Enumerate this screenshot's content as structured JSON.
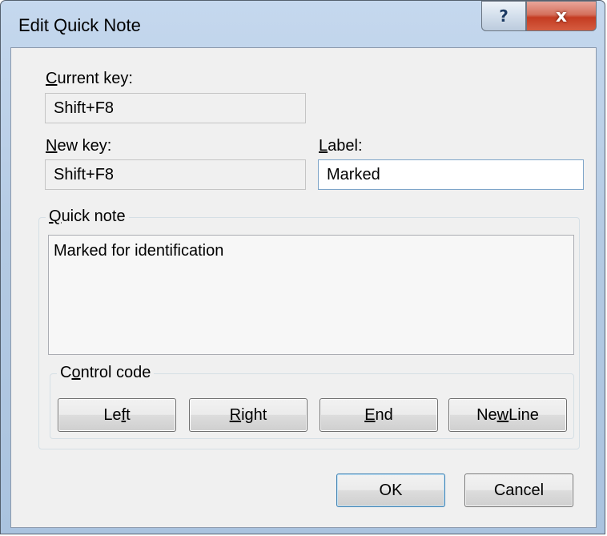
{
  "window": {
    "title": "Edit Quick Note",
    "help_glyph": "?",
    "close_glyph": "x"
  },
  "current_key": {
    "label_mnemonic": "C",
    "label_rest": "urrent key:",
    "value": "Shift+F8"
  },
  "new_key": {
    "label_mnemonic": "N",
    "label_rest": "ew key:",
    "value": "Shift+F8"
  },
  "label_field": {
    "label_mnemonic": "L",
    "label_rest": "abel:",
    "value": "Marked"
  },
  "quick_note": {
    "legend_mnemonic": "Q",
    "legend_rest": "uick note",
    "text": "Marked for identification"
  },
  "control_code": {
    "legend_pre": "C",
    "legend_mnemonic": "o",
    "legend_rest": "ntrol code",
    "buttons": {
      "left": {
        "pre": "Le",
        "mnemonic": "f",
        "post": "t"
      },
      "right": {
        "pre": "",
        "mnemonic": "R",
        "post": "ight"
      },
      "end": {
        "pre": "",
        "mnemonic": "E",
        "post": "nd"
      },
      "new_line": {
        "pre": "Ne",
        "mnemonic": "w",
        "post": " Line"
      }
    }
  },
  "footer": {
    "ok_label": "OK",
    "cancel_label": "Cancel"
  },
  "colors": {
    "frame": "#b4cae3",
    "close_button": "#c43c22",
    "client_bg": "#f0f0f0",
    "focus_border": "#7ea5c9"
  },
  "icons": [
    "help-icon",
    "close-icon"
  ]
}
